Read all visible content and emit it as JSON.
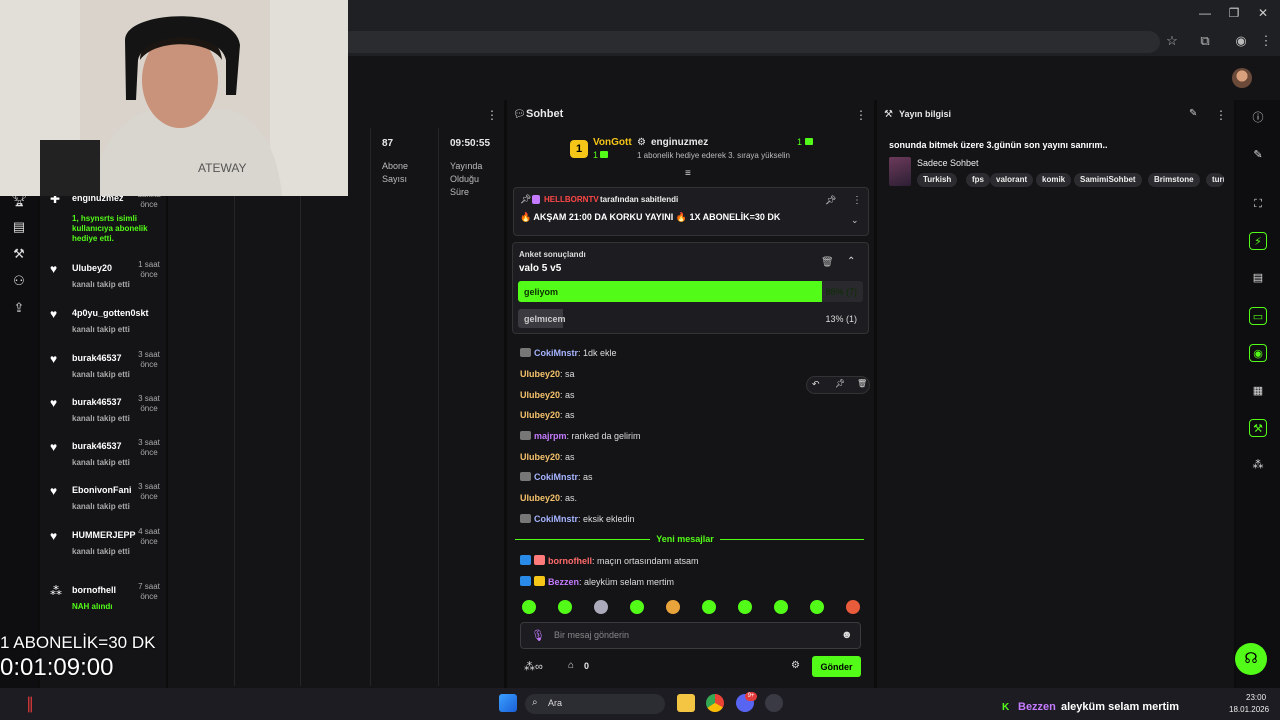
{
  "browser": {
    "win_minimize": "—",
    "win_maximize": "❐",
    "win_close": "✕"
  },
  "activity": {
    "items": [
      {
        "name": "enginuzmez",
        "time": "dakika önce",
        "desc": "1, hsynsrts isimli kullanıcıya abonelik hediye etti."
      },
      {
        "name": "Ulubey20",
        "time": "1 saat önce",
        "desc": "kanalı takip etti"
      },
      {
        "name": "4p0yu_gotten0skt",
        "time": "",
        "desc": "kanalı takip etti"
      },
      {
        "name": "burak46537",
        "time": "3 saat önce",
        "desc": "kanalı takip etti"
      },
      {
        "name": "burak46537",
        "time": "3 saat önce",
        "desc": "kanalı takip etti"
      },
      {
        "name": "burak46537",
        "time": "3 saat önce",
        "desc": "kanalı takip etti"
      },
      {
        "name": "EbonivonFani",
        "time": "3 saat önce",
        "desc": "kanalı takip etti"
      },
      {
        "name": "HUMMERJEPP",
        "time": "4 saat önce",
        "desc": "kanalı takip etti"
      },
      {
        "name": "bornofhell",
        "time": "7 saat önce",
        "desc": "NAH alındı"
      }
    ]
  },
  "stats": {
    "subs_value": "87",
    "subs_label": "Abone Sayısı",
    "uptime_value": "09:50:55",
    "uptime_label": "Yayında Olduğu Süre"
  },
  "chat": {
    "title": "Sohbet",
    "leaderboard": {
      "rank": "1",
      "top_name": "VonGott",
      "top_count": "1",
      "sub_name": "enginuzmez",
      "sub_count": "1",
      "sub_desc": "1 abonelik hediye ederek 3. sıraya yükselin"
    },
    "pinned": {
      "by_user": "HELLBORNTV",
      "by_text": "tarafından sabitlendi",
      "message": "🔥 AKŞAM 21:00 DA KORKU YAYINI 🔥 1X ABONELİK=30 DK"
    },
    "poll": {
      "status": "Anket sonuçlandı",
      "question": "valo 5 v5",
      "options": [
        {
          "label": "geliyom",
          "result": "88% (7)",
          "percent": 88
        },
        {
          "label": "gelmıcem",
          "result": "13% (1)",
          "percent": 13
        }
      ]
    },
    "messages": [
      {
        "user": "CokiMnstr",
        "color": "#a6b4ff",
        "text": ": 1dk ekle"
      },
      {
        "user": "Ulubey20",
        "color": "#f5c26b",
        "text": ": sa"
      },
      {
        "user": "Ulubey20",
        "color": "#f5c26b",
        "text": ": as"
      },
      {
        "user": "Ulubey20",
        "color": "#f5c26b",
        "text": ": as"
      },
      {
        "user": "majrpm",
        "color": "#c47bff",
        "text": ": ranked da gelirim"
      },
      {
        "user": "Ulubey20",
        "color": "#f5c26b",
        "text": ": as"
      },
      {
        "user": "CokiMnstr",
        "color": "#a6b4ff",
        "text": ": as"
      },
      {
        "user": "Ulubey20",
        "color": "#f5c26b",
        "text": ": as."
      },
      {
        "user": "CokiMnstr",
        "color": "#a6b4ff",
        "text": ": eksik ekledin"
      }
    ],
    "new_messages_label": "Yeni mesajlar",
    "new_messages": [
      {
        "user": "bornofhell",
        "color": "#ff6b6b",
        "text": ": maçın ortasındamı atsam"
      },
      {
        "user": "Bezzen",
        "color": "#c47bff",
        "text": ": aleyküm selam mertim"
      }
    ],
    "input_placeholder": "Bir mesaj gönderin",
    "viewers": "0",
    "send_label": "Gönder"
  },
  "info": {
    "title": "Yayın bilgisi",
    "stream_title": "sonunda bitmek üzere 3.günün son yayını sanırım..",
    "category": "Sadece Sohbet",
    "tags": [
      "Turkish",
      "fps",
      "valorant",
      "komik",
      "SamimiSohbet",
      "Brimstone",
      "turkey"
    ]
  },
  "overlay": {
    "subathon_text": "1 ABONELİK=30 DK",
    "timer": "0:01:09:00",
    "overlay_name": "enginuzmez",
    "overlay_time": "önce",
    "overlay_desc": "NAH ALINDI"
  },
  "taskbar": {
    "search": "Ara",
    "notify_badge": "9+",
    "ticker_user": "Bezzen",
    "ticker_msg": "aleyküm selam mertim",
    "clock_time": "23:00",
    "clock_date": "18.01.2026"
  },
  "colors": {
    "accent": "#53fc18",
    "bg": "#141416",
    "panel": "#0e0e10"
  }
}
